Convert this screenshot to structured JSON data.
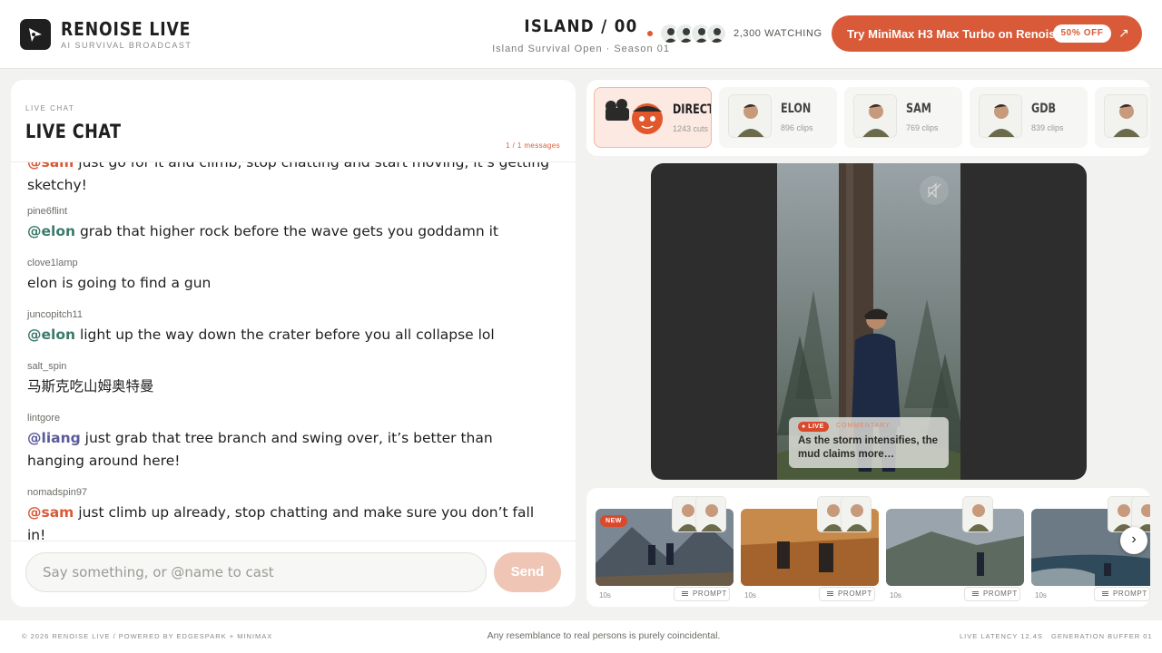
{
  "brand": {
    "title": "RENOISE LIVE",
    "subtitle": "AI SURVIVAL BROADCAST"
  },
  "episode": {
    "title": "ISLAND / 00",
    "subtitle": "Island Survival Open · Season 01"
  },
  "viewers": {
    "watching": "2,300 WATCHING"
  },
  "promo": {
    "label": "Try MiniMax H3 Max Turbo on Renoise",
    "badge": "50% OFF",
    "arrow": "↗"
  },
  "chat": {
    "eyebrow": "LIVE CHAT",
    "title": "LIVE CHAT",
    "count": "1 / 1 messages",
    "input_placeholder": "Say something, or @name to cast",
    "send_label": "Send",
    "messages": [
      {
        "user": "",
        "mention": "@sam",
        "mention_color": "#d95a38",
        "text": " just go for it and climb, stop chatting and start moving, it’s getting sketchy!"
      },
      {
        "user": "pine6flint",
        "mention": "@elon",
        "mention_color": "#3c7a6b",
        "text": " grab that higher rock before the wave gets you goddamn it"
      },
      {
        "user": "clove1lamp",
        "mention": "",
        "mention_color": "",
        "text": "elon is going to find a gun"
      },
      {
        "user": "juncopitch11",
        "mention": "@elon",
        "mention_color": "#3c7a6b",
        "text": " light up the way down the crater before you all collapse lol"
      },
      {
        "user": "salt_spin",
        "mention": "",
        "mention_color": "",
        "text": "马斯克吃山姆奥特曼"
      },
      {
        "user": "lintgore",
        "mention": "@liang",
        "mention_color": "#5a5a9a",
        "text": " just grab that tree branch and swing over, it’s better than hanging around here!"
      },
      {
        "user": "nomadspin97",
        "mention": "@sam",
        "mention_color": "#d95a38",
        "text": " just climb up already, stop chatting and make sure you don’t fall in!"
      }
    ]
  },
  "cast": [
    {
      "name": "DIRECTOR",
      "clips": "1243 cuts",
      "active": true,
      "icon": "camera-mascot-icon"
    },
    {
      "name": "ELON",
      "clips": "896 clips",
      "active": false,
      "icon": "portrait-icon"
    },
    {
      "name": "SAM",
      "clips": "769 clips",
      "active": false,
      "icon": "portrait-icon"
    },
    {
      "name": "GDB",
      "clips": "839 clips",
      "active": false,
      "icon": "portrait-icon"
    },
    {
      "name": "",
      "clips": "",
      "active": false,
      "icon": "portrait-icon"
    }
  ],
  "video": {
    "live_label": "LIVE",
    "commentary_label": "COMMENTARY",
    "commentary_text": "As the storm intensifies, the mud claims more…"
  },
  "clips": [
    {
      "duration": "10s",
      "prompt": "PROMPT",
      "new": true,
      "new_label": "NEW",
      "scene": "mountain"
    },
    {
      "duration": "10s",
      "prompt": "PROMPT",
      "new": false,
      "new_label": "",
      "scene": "desert"
    },
    {
      "duration": "10s",
      "prompt": "PROMPT",
      "new": false,
      "new_label": "",
      "scene": "cliff"
    },
    {
      "duration": "10s",
      "prompt": "PROMPT",
      "new": false,
      "new_label": "",
      "scene": "sea"
    }
  ],
  "footer": {
    "left": "© 2026 RENOISE LIVE / POWERED BY EDGESPARK + MINIMAX",
    "center": "Any resemblance to real persons is purely coincidental.",
    "latency": "LIVE LATENCY 12.4S",
    "buffer": "GENERATION BUFFER 01"
  },
  "colors": {
    "accent": "#d95a38",
    "accent_soft": "#efc5b5",
    "live": "#d94a2c"
  }
}
